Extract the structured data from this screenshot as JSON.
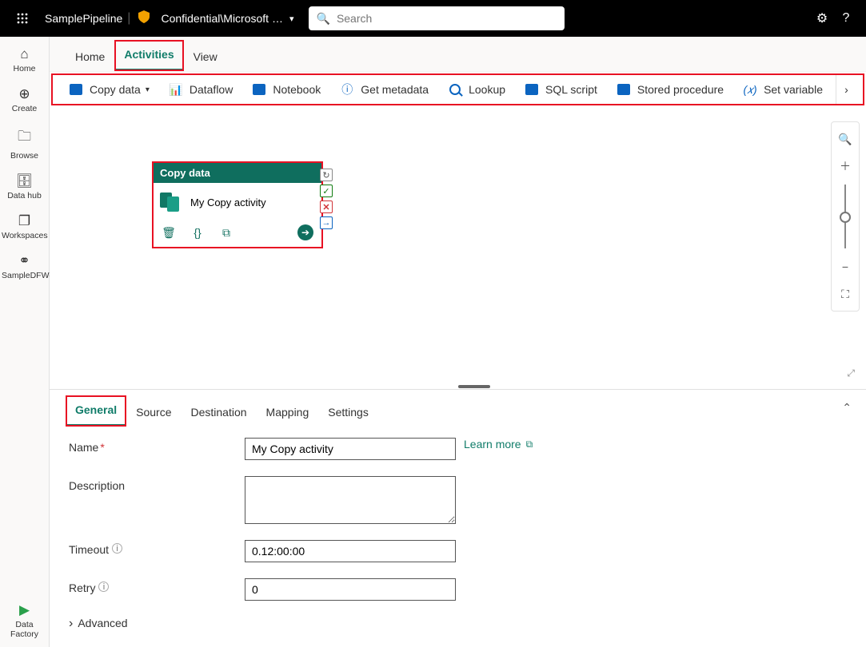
{
  "topbar": {
    "workspaceTitle": "SamplePipeline",
    "breadcrumb": "Confidential\\Microsoft …",
    "searchPlaceholder": "Search"
  },
  "leftnav": {
    "items": [
      {
        "icon": "home-icon",
        "label": "Home"
      },
      {
        "icon": "plus-circle-icon",
        "label": "Create"
      },
      {
        "icon": "folder-icon",
        "label": "Browse"
      },
      {
        "icon": "database-icon",
        "label": "Data hub"
      },
      {
        "icon": "workspaces-icon",
        "label": "Workspaces"
      },
      {
        "icon": "team-icon",
        "label": "SampleDFWorkspace"
      }
    ],
    "bottom": {
      "icon": "factory-icon",
      "label": "Data Factory"
    }
  },
  "pageTabs": [
    {
      "label": "Home",
      "active": false
    },
    {
      "label": "Activities",
      "active": true,
      "highlightRed": true
    },
    {
      "label": "View",
      "active": false
    }
  ],
  "ribbon": [
    {
      "label": "Copy data",
      "hasDropdown": true
    },
    {
      "label": "Dataflow"
    },
    {
      "label": "Notebook"
    },
    {
      "label": "Get metadata"
    },
    {
      "label": "Lookup"
    },
    {
      "label": "SQL script"
    },
    {
      "label": "Stored procedure"
    },
    {
      "label": "Set variable"
    }
  ],
  "activityCard": {
    "typeLabel": "Copy data",
    "name": "My Copy activity"
  },
  "propTabs": [
    {
      "label": "General",
      "active": true,
      "highlightRed": true
    },
    {
      "label": "Source"
    },
    {
      "label": "Destination"
    },
    {
      "label": "Mapping"
    },
    {
      "label": "Settings"
    }
  ],
  "form": {
    "nameLabel": "Name",
    "nameValue": "My Copy activity",
    "learnMore": "Learn more",
    "descLabel": "Description",
    "descValue": "",
    "timeoutLabel": "Timeout",
    "timeoutValue": "0.12:00:00",
    "retryLabel": "Retry",
    "retryValue": "0",
    "advancedLabel": "Advanced"
  }
}
